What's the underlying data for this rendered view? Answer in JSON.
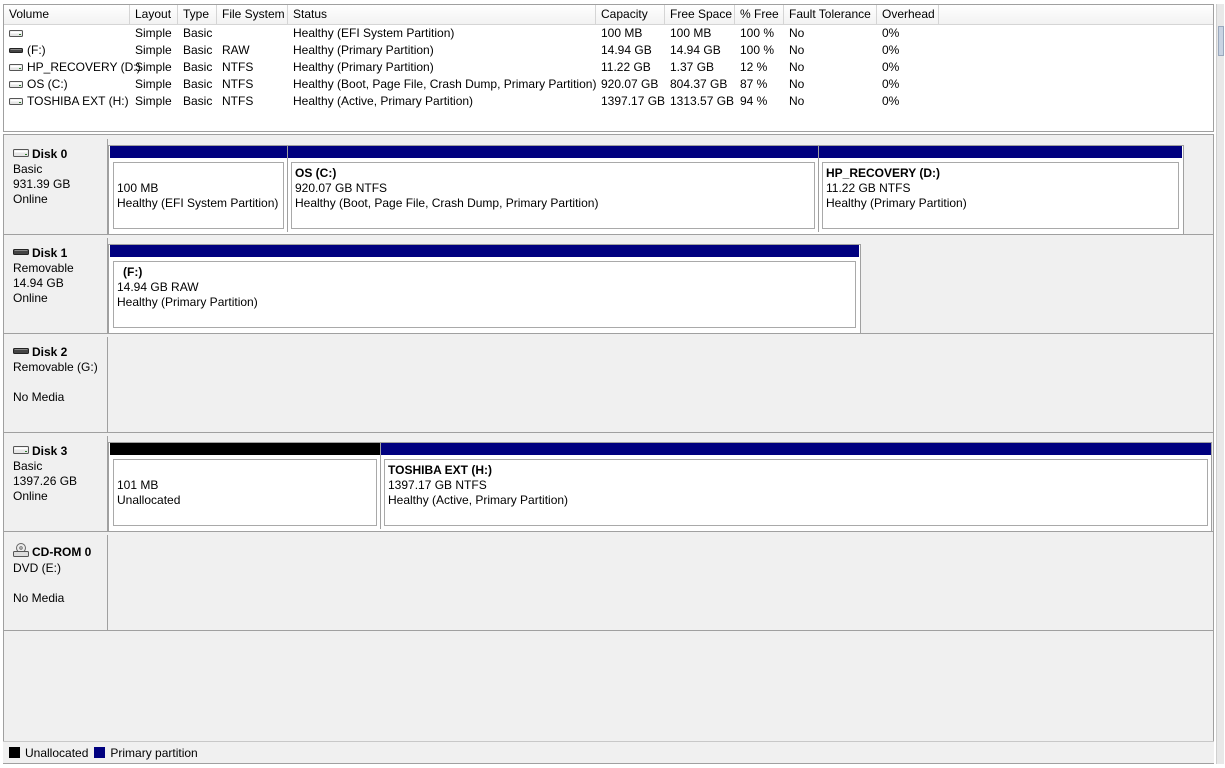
{
  "columns": [
    {
      "label": "Volume"
    },
    {
      "label": "Layout"
    },
    {
      "label": "Type"
    },
    {
      "label": "File System"
    },
    {
      "label": "Status"
    },
    {
      "label": "Capacity"
    },
    {
      "label": "Free Space"
    },
    {
      "label": "% Free"
    },
    {
      "label": "Fault Tolerance"
    },
    {
      "label": "Overhead"
    }
  ],
  "volumes": [
    {
      "volume": "",
      "layout": "Simple",
      "type": "Basic",
      "fs": "",
      "status": "Healthy (EFI System Partition)",
      "capacity": "100 MB",
      "free": "100 MB",
      "pct": "100 %",
      "fault": "No",
      "overhead": "0%"
    },
    {
      "volume": "(F:)",
      "layout": "Simple",
      "type": "Basic",
      "fs": "RAW",
      "status": "Healthy (Primary Partition)",
      "capacity": "14.94 GB",
      "free": "14.94 GB",
      "pct": "100 %",
      "fault": "No",
      "overhead": "0%"
    },
    {
      "volume": "HP_RECOVERY (D:)",
      "layout": "Simple",
      "type": "Basic",
      "fs": "NTFS",
      "status": "Healthy (Primary Partition)",
      "capacity": "11.22 GB",
      "free": "1.37 GB",
      "pct": "12 %",
      "fault": "No",
      "overhead": "0%"
    },
    {
      "volume": "OS (C:)",
      "layout": "Simple",
      "type": "Basic",
      "fs": "NTFS",
      "status": "Healthy (Boot, Page File, Crash Dump, Primary Partition)",
      "capacity": "920.07 GB",
      "free": "804.37 GB",
      "pct": "87 %",
      "fault": "No",
      "overhead": "0%"
    },
    {
      "volume": "TOSHIBA EXT (H:)",
      "layout": "Simple",
      "type": "Basic",
      "fs": "NTFS",
      "status": "Healthy (Active, Primary Partition)",
      "capacity": "1397.17 GB",
      "free": "1313.57 GB",
      "pct": "94 %",
      "fault": "No",
      "overhead": "0%"
    }
  ],
  "disks": [
    {
      "title": "Disk 0",
      "line1": "Basic",
      "line2": "931.39 GB",
      "line3": "Online",
      "partitions": [
        {
          "name": "",
          "size": "100 MB",
          "status": "Healthy (EFI System Partition)"
        },
        {
          "name": "OS  (C:)",
          "size": "920.07 GB NTFS",
          "status": "Healthy (Boot, Page File, Crash Dump, Primary Partition)"
        },
        {
          "name": "HP_RECOVERY  (D:)",
          "size": "11.22 GB NTFS",
          "status": "Healthy (Primary Partition)"
        }
      ]
    },
    {
      "title": "Disk 1",
      "line1": "Removable",
      "line2": "14.94 GB",
      "line3": "Online",
      "partitions": [
        {
          "name": "(F:)",
          "size": "14.94 GB RAW",
          "status": "Healthy (Primary Partition)"
        }
      ]
    },
    {
      "title": "Disk 2",
      "line1": "Removable (G:)",
      "line2": "",
      "line3": "No Media",
      "partitions": []
    },
    {
      "title": "Disk 3",
      "line1": "Basic",
      "line2": "1397.26 GB",
      "line3": "Online",
      "partitions": [
        {
          "name": "",
          "size": "101 MB",
          "status": "Unallocated"
        },
        {
          "name": "TOSHIBA EXT  (H:)",
          "size": "1397.17 GB NTFS",
          "status": "Healthy (Active, Primary Partition)"
        }
      ]
    },
    {
      "title": "CD-ROM 0",
      "line1": "DVD (E:)",
      "line2": "",
      "line3": "No Media",
      "partitions": []
    }
  ],
  "legend": {
    "unallocated_label": "Unallocated",
    "primary_label": "Primary partition",
    "unallocated_color": "#000000",
    "primary_color": "#00007f"
  },
  "icons": {
    "drive": "hard-drive-icon",
    "cdrom": "cd-drive-icon"
  }
}
